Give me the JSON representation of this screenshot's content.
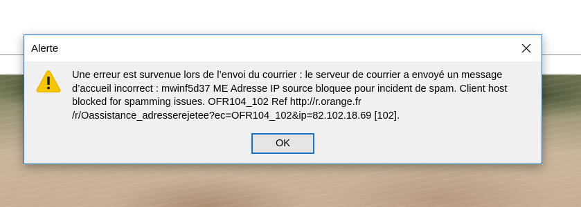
{
  "dialog": {
    "title": "Alerte",
    "close_icon": "close-icon",
    "warning_icon": "warning-icon",
    "message_lines": [
      "Une erreur est survenue lors de l’envoi du courrier : le serveur de courrier a envoyé un message",
      "d’accueil incorrect : mwinf5d37 ME Adresse IP source bloquee pour incident de spam. Client host",
      "blocked for spamming issues. OFR104_102 Ref http://r.orange.fr",
      "/r/Oassistance_adresserejetee?ec=OFR104_102&ip=82.102.18.69 [102]."
    ],
    "ok_label": "OK"
  },
  "colors": {
    "dialog_border": "#1a73c8",
    "warning_fill": "#f7c400",
    "button_focus_border": "#1773d0"
  }
}
